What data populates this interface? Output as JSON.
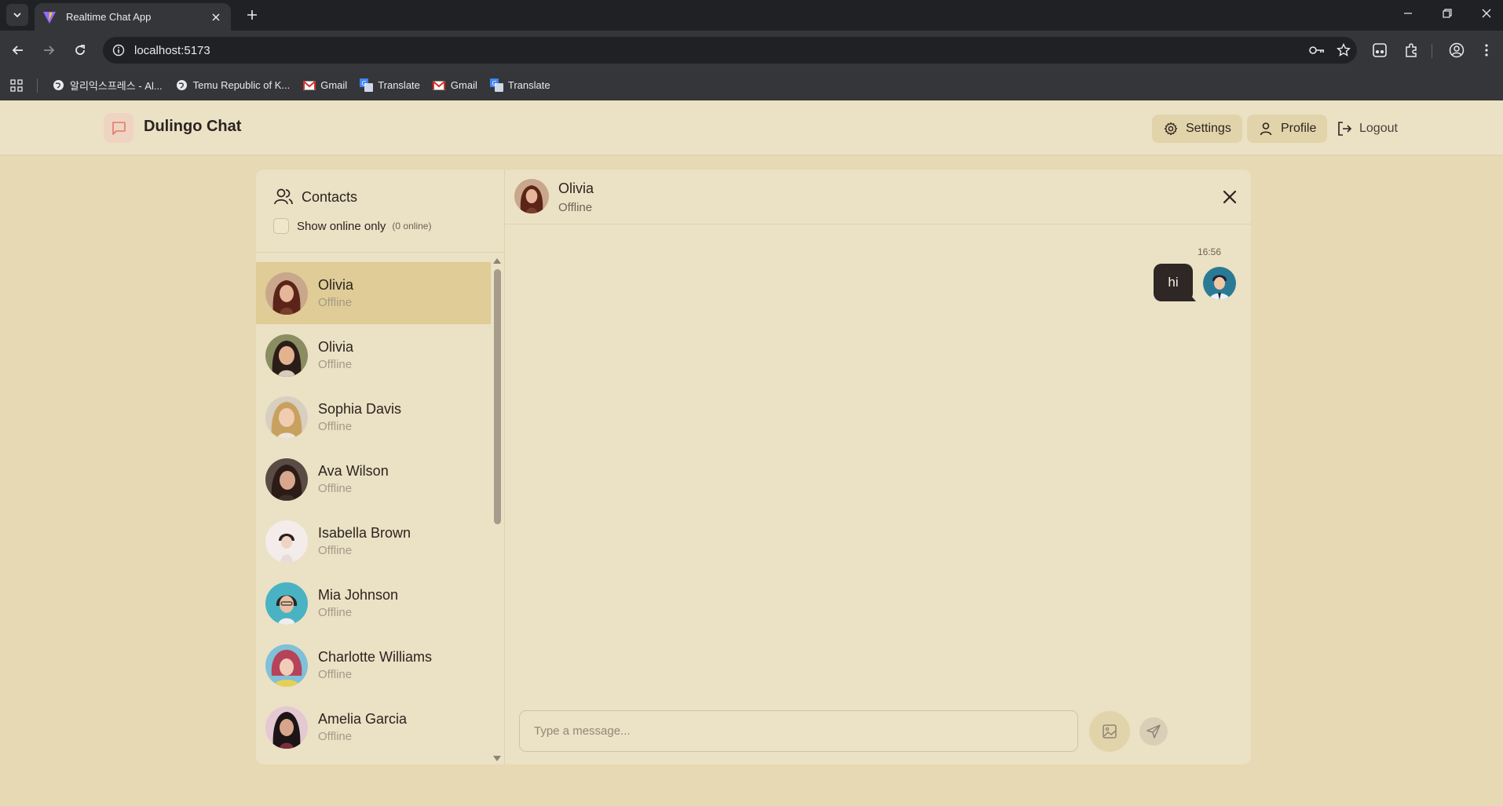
{
  "browser": {
    "tab_title": "Realtime Chat App",
    "url": "localhost:5173",
    "bookmarks": [
      {
        "label": "알리익스프레스 - Al...",
        "icon": "globe-icon"
      },
      {
        "label": "Temu Republic of K...",
        "icon": "globe-icon"
      },
      {
        "label": "Gmail",
        "icon": "gmail-icon"
      },
      {
        "label": "Translate",
        "icon": "translate-icon"
      },
      {
        "label": "Gmail",
        "icon": "gmail-icon"
      },
      {
        "label": "Translate",
        "icon": "translate-icon"
      }
    ]
  },
  "header": {
    "brand": "Dulingo Chat",
    "settings_label": "Settings",
    "profile_label": "Profile",
    "logout_label": "Logout"
  },
  "sidebar": {
    "title": "Contacts",
    "online_filter_label": "Show online only",
    "online_count": "(0 online)",
    "contacts": [
      {
        "name": "Olivia",
        "status": "Offline",
        "selected": true
      },
      {
        "name": "Olivia",
        "status": "Offline"
      },
      {
        "name": "Sophia Davis",
        "status": "Offline"
      },
      {
        "name": "Ava Wilson",
        "status": "Offline"
      },
      {
        "name": "Isabella Brown",
        "status": "Offline"
      },
      {
        "name": "Mia Johnson",
        "status": "Offline"
      },
      {
        "name": "Charlotte Williams",
        "status": "Offline"
      },
      {
        "name": "Amelia Garcia",
        "status": "Offline"
      }
    ]
  },
  "chat": {
    "name": "Olivia",
    "status": "Offline",
    "messages": [
      {
        "time": "16:56",
        "text": "hi",
        "own": true
      }
    ],
    "composer_placeholder": "Type a message..."
  },
  "colors": {
    "page_bg": "#e6d9b3",
    "panel_bg": "#ebe1c4",
    "selected_contact": "#dfcc96",
    "bubble_own": "#2f2725",
    "brand_icon_bg": "#f0d4c3",
    "brand_icon_stroke": "#e07a6a"
  }
}
